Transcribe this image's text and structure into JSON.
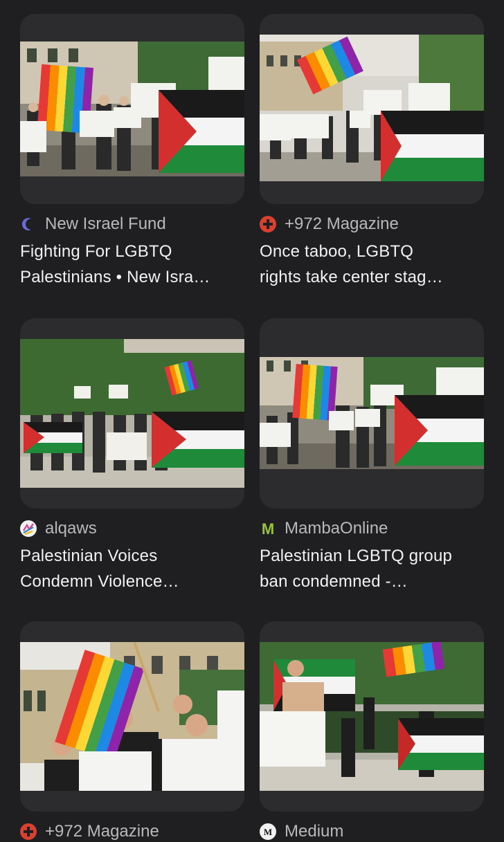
{
  "results": [
    {
      "source": "New Israel Fund",
      "source_icon": "moon-icon",
      "title_line1": "Fighting For LGBTQ",
      "title_line2": "Palestinians • New Isra…"
    },
    {
      "source": "+972 Magazine",
      "source_icon": "plus-circle-icon",
      "title_line1": "Once taboo, LGBTQ",
      "title_line2": "rights take center stag…"
    },
    {
      "source": "alqaws",
      "source_icon": "alqaws-logo-icon",
      "title_line1": "Palestinian Voices",
      "title_line2": "Condemn Violence…"
    },
    {
      "source": "MambaOnline",
      "source_icon": "mamba-m-icon",
      "title_line1": "Palestinian LGBTQ group",
      "title_line2": "ban condemned -…"
    },
    {
      "source": "+972 Magazine",
      "source_icon": "plus-circle-icon"
    },
    {
      "source": "Medium",
      "source_icon": "medium-logo-icon"
    }
  ],
  "colors": {
    "background": "#1f1f21",
    "card": "#2c2c2f",
    "nif_icon": "#6b6ad8",
    "m972_icon": "#d8412f",
    "mamba_icon": "#9ac43a"
  }
}
